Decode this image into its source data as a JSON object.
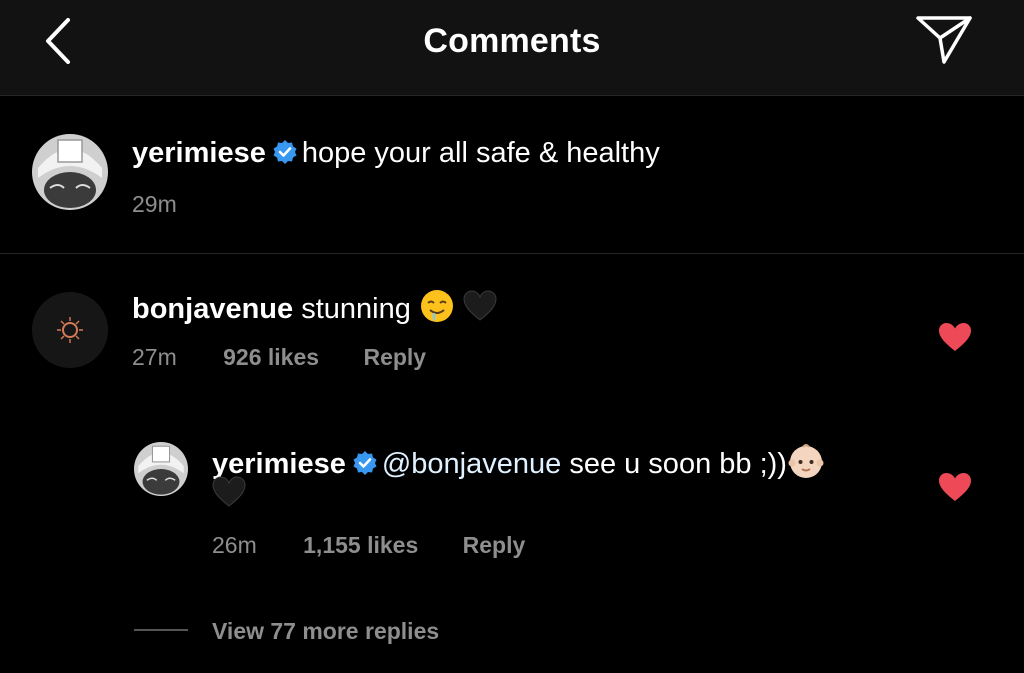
{
  "header": {
    "title": "Comments"
  },
  "caption": {
    "username": "yerimiese",
    "text": "hope your all safe & healthy",
    "time": "29m"
  },
  "comment": {
    "username": "bonjavenue",
    "text": "stunning",
    "time": "27m",
    "likes": "926 likes",
    "reply": "Reply"
  },
  "reply": {
    "username": "yerimiese",
    "mention": "@bonjavenue",
    "text": "see u soon bb ;))",
    "time": "26m",
    "likes": "1,155 likes",
    "reply": "Reply"
  },
  "view_more": "View 77 more replies",
  "colors": {
    "background": "#000000",
    "header": "#121212",
    "muted": "#8e8e8e",
    "verified": "#3897f0",
    "heart": "#ed4956"
  },
  "icons": [
    "back-chevron-icon",
    "send-icon",
    "verified-icon",
    "heart-icon",
    "drooling-face-emoji",
    "black-heart-emoji",
    "baby-emoji"
  ]
}
